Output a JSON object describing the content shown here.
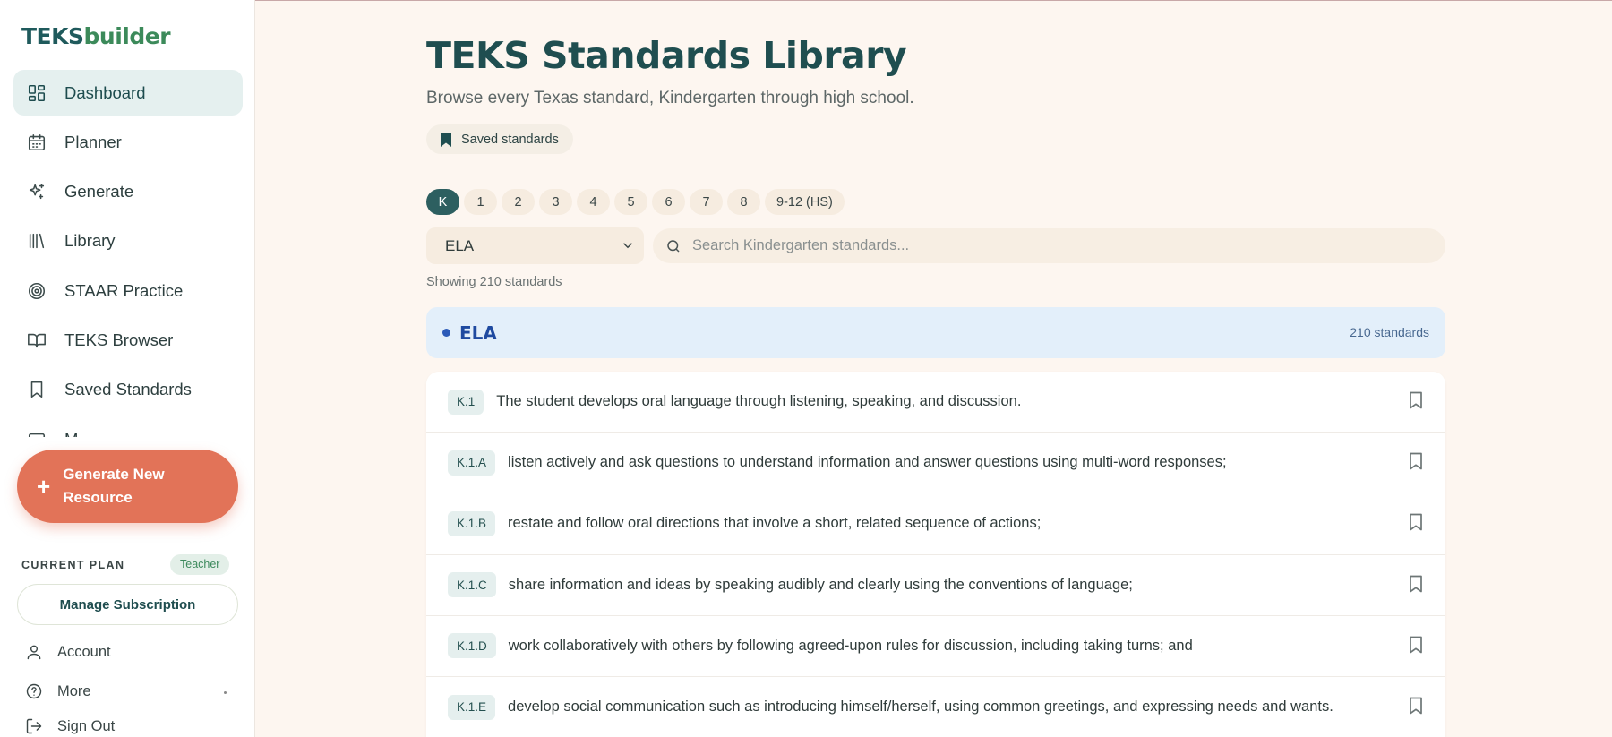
{
  "app": {
    "logo_a": "TEKS",
    "logo_b": "builder"
  },
  "sidebar": {
    "items": [
      {
        "label": "Dashboard",
        "icon": "dashboard-icon",
        "active": true
      },
      {
        "label": "Planner",
        "icon": "calendar-icon"
      },
      {
        "label": "Generate",
        "icon": "sparkles-icon"
      },
      {
        "label": "Library",
        "icon": "library-icon"
      },
      {
        "label": "STAAR Practice",
        "icon": "target-icon"
      },
      {
        "label": "TEKS Browser",
        "icon": "book-open-icon"
      },
      {
        "label": "Saved Standards",
        "icon": "bookmark-icon"
      },
      {
        "label": "M...",
        "icon": "folder-icon"
      }
    ],
    "generate_label": "Generate New Resource",
    "plan_label": "CURRENT PLAN",
    "plan_badge": "Teacher",
    "manage_label": "Manage Subscription",
    "account_label": "Account",
    "more_label": "More",
    "signout_label": "Sign Out"
  },
  "main": {
    "title": "TEKS Standards Library",
    "subtitle": "Browse every Texas standard, Kindergarten through high school.",
    "saved_label": "Saved standards",
    "grades": [
      "K",
      "1",
      "2",
      "3",
      "4",
      "5",
      "6",
      "7",
      "8",
      "9-12 (HS)"
    ],
    "active_grade": "K",
    "subject_selected": "ELA",
    "search_placeholder": "Search Kindergarten standards...",
    "showing": "Showing 210 standards",
    "subject_name": "ELA",
    "subject_count": "210 standards",
    "standards": [
      {
        "code": "K.1",
        "text": "The student develops oral language through listening, speaking, and discussion."
      },
      {
        "code": "K.1.A",
        "text": "listen actively and ask questions to understand information and answer questions using multi-word responses;"
      },
      {
        "code": "K.1.B",
        "text": "restate and follow oral directions that involve a short, related sequence of actions;"
      },
      {
        "code": "K.1.C",
        "text": "share information and ideas by speaking audibly and clearly using the conventions of language;"
      },
      {
        "code": "K.1.D",
        "text": "work collaboratively with others by following agreed-upon rules for discussion, including taking turns; and"
      },
      {
        "code": "K.1.E",
        "text": "develop social communication such as introducing himself/herself, using common greetings, and expressing needs and wants."
      }
    ]
  },
  "colors": {
    "accent_teal": "#1f4e50",
    "cta_coral": "#e27358",
    "subject_blue": "#1f4aa0",
    "background": "#fdf6f0"
  }
}
